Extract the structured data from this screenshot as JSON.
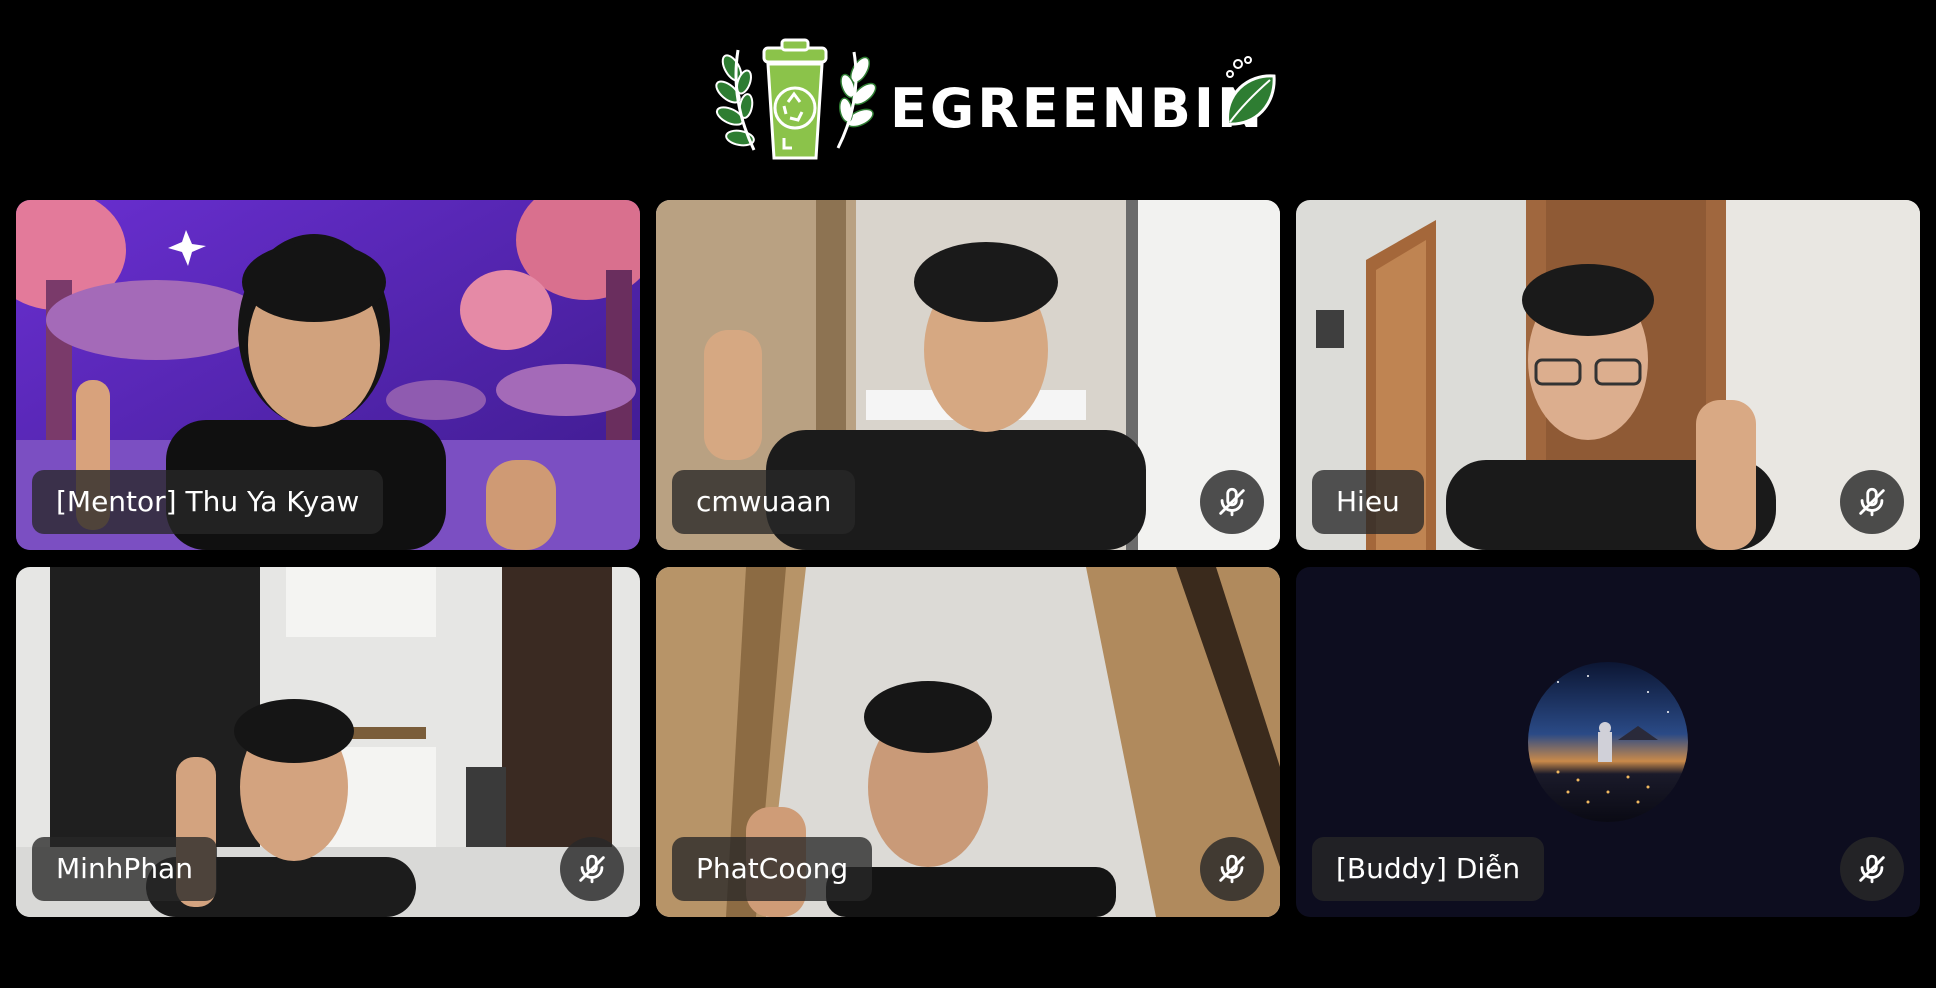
{
  "header": {
    "logo_text": "EGREENBIN",
    "logo_icon": "recycle-bin-icon"
  },
  "colors": {
    "background": "#000000",
    "brand_green": "#8bc34a",
    "brand_dark_green": "#2e7d32",
    "tile_empty": "#0d0d1f",
    "nametag_bg": "#282828"
  },
  "participants": [
    {
      "name": "[Mentor] Thu Ya Kyaw",
      "muted": false,
      "video": true
    },
    {
      "name": "cmwuaan",
      "muted": true,
      "video": true
    },
    {
      "name": "Hieu",
      "muted": true,
      "video": true
    },
    {
      "name": "MinhPhan",
      "muted": true,
      "video": true
    },
    {
      "name": "PhatCoong",
      "muted": true,
      "video": true
    },
    {
      "name": "[Buddy] Diễn",
      "muted": true,
      "video": false
    }
  ],
  "icons": {
    "mute": "mic-off-icon",
    "avatar": "avatar-image"
  }
}
